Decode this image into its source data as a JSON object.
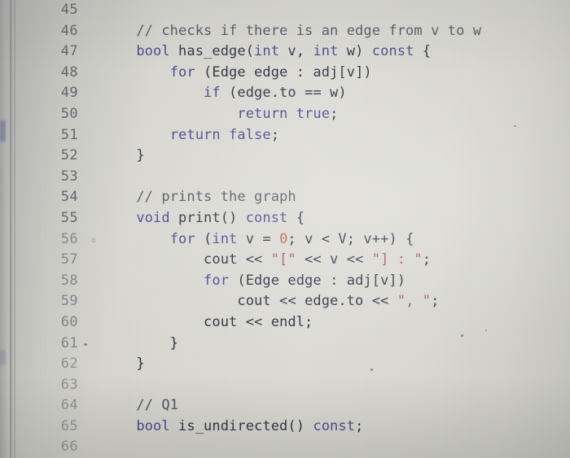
{
  "app": {
    "kind": "code-editor-screenshot",
    "language": "C++",
    "colors": {
      "background": "#d5d4cd",
      "plain_text": "#23263a",
      "comment": "#4a4d58",
      "keyword": "#3a3f8c",
      "string": "#a4465e",
      "number": "#b85a30",
      "line_number": "#4c4f57"
    }
  },
  "editor": {
    "first_line_number": 45,
    "last_line_number": 66,
    "lines": [
      {
        "number": "45",
        "text": ""
      },
      {
        "number": "46",
        "text": "    // checks if there is an edge from v to w"
      },
      {
        "number": "47",
        "text": "    bool has_edge(int v, int w) const {"
      },
      {
        "number": "48",
        "text": "        for (Edge edge : adj[v])"
      },
      {
        "number": "49",
        "text": "            if (edge.to == w)"
      },
      {
        "number": "50",
        "text": "                return true;"
      },
      {
        "number": "51",
        "text": "        return false;"
      },
      {
        "number": "52",
        "text": "    }"
      },
      {
        "number": "53",
        "text": ""
      },
      {
        "number": "54",
        "text": "    // prints the graph"
      },
      {
        "number": "55",
        "text": "    void print() const {"
      },
      {
        "number": "56",
        "text": "        for (int v = 0; v < V; v++) {"
      },
      {
        "number": "57",
        "text": "            cout << \"[\" << v << \"] : \";"
      },
      {
        "number": "58",
        "text": "            for (Edge edge : adj[v])"
      },
      {
        "number": "59",
        "text": "                cout << edge.to << \", \";"
      },
      {
        "number": "60",
        "text": "            cout << endl;"
      },
      {
        "number": "61",
        "text": "        }"
      },
      {
        "number": "62",
        "text": "    }"
      },
      {
        "number": "63",
        "text": ""
      },
      {
        "number": "64",
        "text": "    // Q1"
      },
      {
        "number": "65",
        "text": "    bool is_undirected() const;"
      },
      {
        "number": "66",
        "text": ""
      }
    ],
    "tokens": {
      "l46": [
        {
          "t": "    ",
          "c": "pln"
        },
        {
          "t": "// checks if there is an edge from v to w",
          "c": "cmt"
        }
      ],
      "l47": [
        {
          "t": "    ",
          "c": "pln"
        },
        {
          "t": "bool",
          "c": "kw"
        },
        {
          "t": " has_edge(",
          "c": "pln"
        },
        {
          "t": "int",
          "c": "kw"
        },
        {
          "t": " v, ",
          "c": "pln"
        },
        {
          "t": "int",
          "c": "kw"
        },
        {
          "t": " w) ",
          "c": "pln"
        },
        {
          "t": "const",
          "c": "kw"
        },
        {
          "t": " {",
          "c": "pln"
        }
      ],
      "l48": [
        {
          "t": "        ",
          "c": "pln"
        },
        {
          "t": "for",
          "c": "kw"
        },
        {
          "t": " (Edge edge : adj[v])",
          "c": "pln"
        }
      ],
      "l49": [
        {
          "t": "            ",
          "c": "pln"
        },
        {
          "t": "if",
          "c": "kw"
        },
        {
          "t": " (edge.to == w)",
          "c": "pln"
        }
      ],
      "l50": [
        {
          "t": "                ",
          "c": "pln"
        },
        {
          "t": "return",
          "c": "kw"
        },
        {
          "t": " ",
          "c": "pln"
        },
        {
          "t": "true",
          "c": "kw"
        },
        {
          "t": ";",
          "c": "pln"
        }
      ],
      "l51": [
        {
          "t": "        ",
          "c": "pln"
        },
        {
          "t": "return",
          "c": "kw"
        },
        {
          "t": " ",
          "c": "pln"
        },
        {
          "t": "false",
          "c": "kw"
        },
        {
          "t": ";",
          "c": "pln"
        }
      ],
      "l52": [
        {
          "t": "    }",
          "c": "pln"
        }
      ],
      "l54": [
        {
          "t": "    ",
          "c": "pln"
        },
        {
          "t": "// prints the graph",
          "c": "cmt"
        }
      ],
      "l55": [
        {
          "t": "    ",
          "c": "pln"
        },
        {
          "t": "void",
          "c": "kw"
        },
        {
          "t": " print() ",
          "c": "pln"
        },
        {
          "t": "const",
          "c": "kw"
        },
        {
          "t": " {",
          "c": "pln"
        }
      ],
      "l56": [
        {
          "t": "        ",
          "c": "pln"
        },
        {
          "t": "for",
          "c": "kw"
        },
        {
          "t": " (",
          "c": "pln"
        },
        {
          "t": "int",
          "c": "kw"
        },
        {
          "t": " v = ",
          "c": "pln"
        },
        {
          "t": "0",
          "c": "num"
        },
        {
          "t": "; v < V; v++) {",
          "c": "pln"
        }
      ],
      "l57": [
        {
          "t": "            cout << ",
          "c": "pln"
        },
        {
          "t": "\"[\"",
          "c": "str"
        },
        {
          "t": " << v << ",
          "c": "pln"
        },
        {
          "t": "\"] : \"",
          "c": "str"
        },
        {
          "t": ";",
          "c": "pln"
        }
      ],
      "l58": [
        {
          "t": "            ",
          "c": "pln"
        },
        {
          "t": "for",
          "c": "kw"
        },
        {
          "t": " (Edge edge : adj[v])",
          "c": "pln"
        }
      ],
      "l59": [
        {
          "t": "                cout << edge.to << ",
          "c": "pln"
        },
        {
          "t": "\", \"",
          "c": "str"
        },
        {
          "t": ";",
          "c": "pln"
        }
      ],
      "l60": [
        {
          "t": "            cout << endl;",
          "c": "pln"
        }
      ],
      "l61": [
        {
          "t": "        }",
          "c": "pln"
        }
      ],
      "l62": [
        {
          "t": "    }",
          "c": "pln"
        }
      ],
      "l64": [
        {
          "t": "    ",
          "c": "pln"
        },
        {
          "t": "// Q1",
          "c": "cmt"
        }
      ],
      "l65": [
        {
          "t": "    ",
          "c": "pln"
        },
        {
          "t": "bool",
          "c": "kw"
        },
        {
          "t": " is_undirected() ",
          "c": "pln"
        },
        {
          "t": "const",
          "c": "kw"
        },
        {
          "t": ";",
          "c": "pln"
        }
      ]
    }
  }
}
